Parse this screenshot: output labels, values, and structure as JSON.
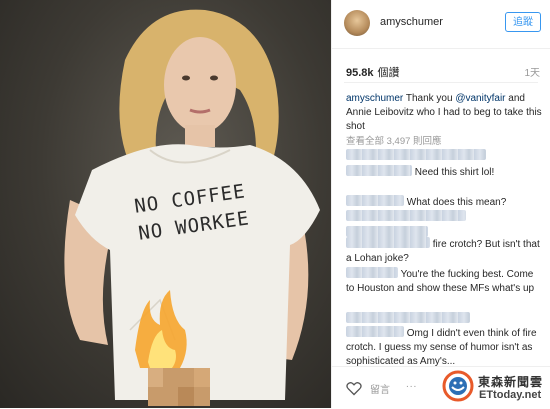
{
  "header": {
    "username": "amyschumer",
    "follow_label": "追蹤"
  },
  "stats": {
    "likes": "95.8k",
    "likes_label": "個讚",
    "time": "1天"
  },
  "caption": {
    "user": "amyschumer",
    "text_a": " Thank you ",
    "mention": "@vanityfair",
    "text_b": " and Annie Leibovitz who I had to beg to take this shot"
  },
  "view_all": "查看全部 3,497 則回應",
  "comments": [
    {
      "text": "Need this shirt lol!"
    },
    {
      "text": "What does this mean?"
    },
    {
      "text": "fire crotch? But isn't that a Lohan joke?"
    },
    {
      "text": "You're the fucking best. Come to Houston and show these MFs what's up"
    },
    {
      "text": "Omg I didn't even think of fire crotch. I guess my sense of humor isn't as sophisticated as Amy's..."
    }
  ],
  "photo": {
    "shirt_line1": "NO COFFEE",
    "shirt_line2": "NO WORKEE"
  },
  "actions": {
    "comment_placeholder": "留言",
    "more": "..."
  },
  "watermark": {
    "cn": "東森新聞雲",
    "en": "ETtoday.net"
  }
}
